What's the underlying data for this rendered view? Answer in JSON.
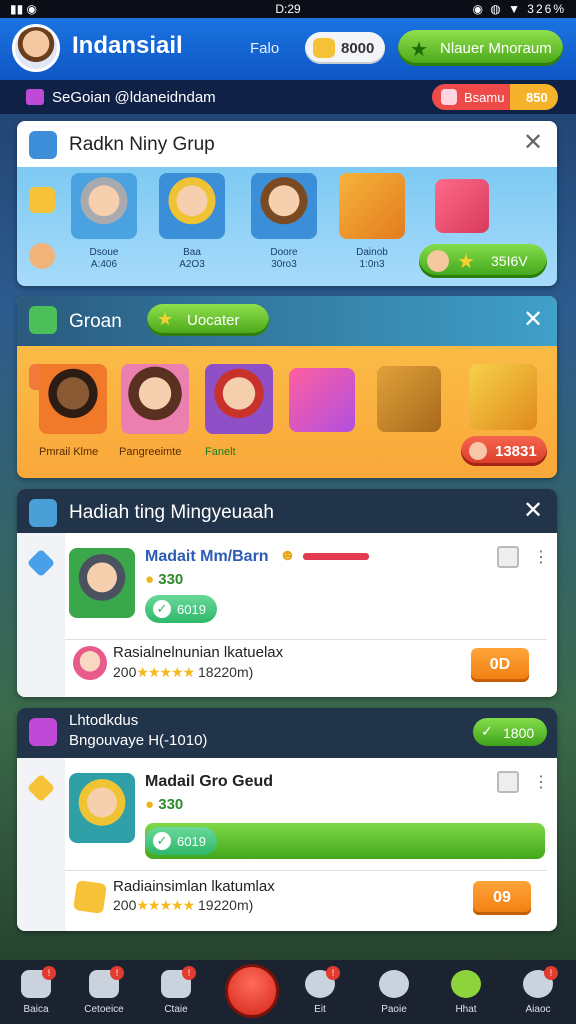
{
  "status": {
    "left": "▮▮ ◉",
    "time": "D:29",
    "right": "◉ ◍ ▼ 326%"
  },
  "appbar": {
    "title": "Indansiail",
    "link": "Falo",
    "coins": "8000",
    "museum_label": "Nlauer Mnoraum"
  },
  "subheader": {
    "text": "SeGoian @ldaneidndam",
    "pill_label": "Bsamu",
    "pill_value": "850"
  },
  "card1": {
    "title": "Radkn Niny Grup",
    "characters": [
      {
        "cap1": "Dsoue",
        "cap2": "A:406"
      },
      {
        "cap1": "Baa",
        "cap2": "A2O3"
      },
      {
        "cap1": "Doore",
        "cap2": "30ro3"
      },
      {
        "cap1": "Dainob",
        "cap2": "1:0n3"
      }
    ],
    "button_value": "35I6V"
  },
  "card2": {
    "title": "Groan",
    "button_label": "Uocater",
    "captions": [
      "Pmrail Klme",
      "Pangreeimte",
      "Fanelt"
    ],
    "red_value": "13831"
  },
  "card3": {
    "title": "Hadiah ting Mingyeuaah",
    "item_title": "Madait Mm/Barn",
    "gold": "330",
    "pill": "6019",
    "row_text": "Rasialnelnunian lkatuelax",
    "row_sub_prefix": "200",
    "row_stars": "★★★★★",
    "row_sub_suffix": "18220m)",
    "action": "0D"
  },
  "card4": {
    "title_line1": "Lhtodkdus",
    "title_line2": "Bngouvaye H(-1010)",
    "chip": "1800",
    "item_title": "Madail Gro Geud",
    "gold": "330",
    "progress_label": "6019",
    "row_text": "Radiainsimlan lkatumlax",
    "row_sub_prefix": "200",
    "row_stars": "★★★★★",
    "row_sub_suffix": "19220m)",
    "action": "09"
  },
  "nav": [
    {
      "label": "Baica",
      "icon": "home-icon"
    },
    {
      "label": "Cetoeice",
      "icon": "shop-icon"
    },
    {
      "label": "Ctaie",
      "icon": "chat-icon"
    },
    {
      "label": "",
      "icon": "play-icon"
    },
    {
      "label": "Eit",
      "icon": "gift-icon"
    },
    {
      "label": "Paoie",
      "icon": "tools-icon"
    },
    {
      "label": "Hhat",
      "icon": "smile-icon"
    },
    {
      "label": "Aiaoc",
      "icon": "people-icon"
    }
  ]
}
